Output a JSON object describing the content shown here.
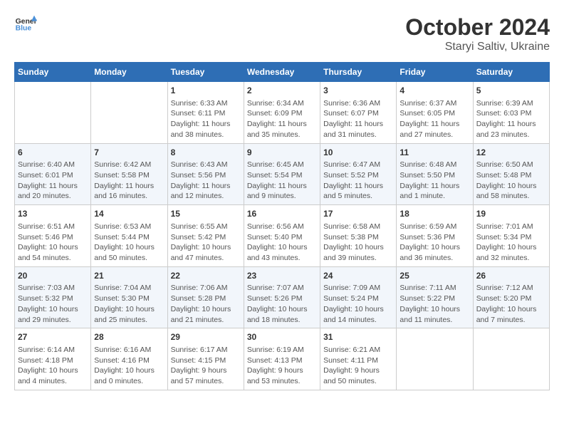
{
  "header": {
    "logo_general": "General",
    "logo_blue": "Blue",
    "month_year": "October 2024",
    "location": "Staryi Saltiv, Ukraine"
  },
  "weekdays": [
    "Sunday",
    "Monday",
    "Tuesday",
    "Wednesday",
    "Thursday",
    "Friday",
    "Saturday"
  ],
  "weeks": [
    [
      {
        "day": "",
        "info": ""
      },
      {
        "day": "",
        "info": ""
      },
      {
        "day": "1",
        "info": "Sunrise: 6:33 AM\nSunset: 6:11 PM\nDaylight: 11 hours and 38 minutes."
      },
      {
        "day": "2",
        "info": "Sunrise: 6:34 AM\nSunset: 6:09 PM\nDaylight: 11 hours and 35 minutes."
      },
      {
        "day": "3",
        "info": "Sunrise: 6:36 AM\nSunset: 6:07 PM\nDaylight: 11 hours and 31 minutes."
      },
      {
        "day": "4",
        "info": "Sunrise: 6:37 AM\nSunset: 6:05 PM\nDaylight: 11 hours and 27 minutes."
      },
      {
        "day": "5",
        "info": "Sunrise: 6:39 AM\nSunset: 6:03 PM\nDaylight: 11 hours and 23 minutes."
      }
    ],
    [
      {
        "day": "6",
        "info": "Sunrise: 6:40 AM\nSunset: 6:01 PM\nDaylight: 11 hours and 20 minutes."
      },
      {
        "day": "7",
        "info": "Sunrise: 6:42 AM\nSunset: 5:58 PM\nDaylight: 11 hours and 16 minutes."
      },
      {
        "day": "8",
        "info": "Sunrise: 6:43 AM\nSunset: 5:56 PM\nDaylight: 11 hours and 12 minutes."
      },
      {
        "day": "9",
        "info": "Sunrise: 6:45 AM\nSunset: 5:54 PM\nDaylight: 11 hours and 9 minutes."
      },
      {
        "day": "10",
        "info": "Sunrise: 6:47 AM\nSunset: 5:52 PM\nDaylight: 11 hours and 5 minutes."
      },
      {
        "day": "11",
        "info": "Sunrise: 6:48 AM\nSunset: 5:50 PM\nDaylight: 11 hours and 1 minute."
      },
      {
        "day": "12",
        "info": "Sunrise: 6:50 AM\nSunset: 5:48 PM\nDaylight: 10 hours and 58 minutes."
      }
    ],
    [
      {
        "day": "13",
        "info": "Sunrise: 6:51 AM\nSunset: 5:46 PM\nDaylight: 10 hours and 54 minutes."
      },
      {
        "day": "14",
        "info": "Sunrise: 6:53 AM\nSunset: 5:44 PM\nDaylight: 10 hours and 50 minutes."
      },
      {
        "day": "15",
        "info": "Sunrise: 6:55 AM\nSunset: 5:42 PM\nDaylight: 10 hours and 47 minutes."
      },
      {
        "day": "16",
        "info": "Sunrise: 6:56 AM\nSunset: 5:40 PM\nDaylight: 10 hours and 43 minutes."
      },
      {
        "day": "17",
        "info": "Sunrise: 6:58 AM\nSunset: 5:38 PM\nDaylight: 10 hours and 39 minutes."
      },
      {
        "day": "18",
        "info": "Sunrise: 6:59 AM\nSunset: 5:36 PM\nDaylight: 10 hours and 36 minutes."
      },
      {
        "day": "19",
        "info": "Sunrise: 7:01 AM\nSunset: 5:34 PM\nDaylight: 10 hours and 32 minutes."
      }
    ],
    [
      {
        "day": "20",
        "info": "Sunrise: 7:03 AM\nSunset: 5:32 PM\nDaylight: 10 hours and 29 minutes."
      },
      {
        "day": "21",
        "info": "Sunrise: 7:04 AM\nSunset: 5:30 PM\nDaylight: 10 hours and 25 minutes."
      },
      {
        "day": "22",
        "info": "Sunrise: 7:06 AM\nSunset: 5:28 PM\nDaylight: 10 hours and 21 minutes."
      },
      {
        "day": "23",
        "info": "Sunrise: 7:07 AM\nSunset: 5:26 PM\nDaylight: 10 hours and 18 minutes."
      },
      {
        "day": "24",
        "info": "Sunrise: 7:09 AM\nSunset: 5:24 PM\nDaylight: 10 hours and 14 minutes."
      },
      {
        "day": "25",
        "info": "Sunrise: 7:11 AM\nSunset: 5:22 PM\nDaylight: 10 hours and 11 minutes."
      },
      {
        "day": "26",
        "info": "Sunrise: 7:12 AM\nSunset: 5:20 PM\nDaylight: 10 hours and 7 minutes."
      }
    ],
    [
      {
        "day": "27",
        "info": "Sunrise: 6:14 AM\nSunset: 4:18 PM\nDaylight: 10 hours and 4 minutes."
      },
      {
        "day": "28",
        "info": "Sunrise: 6:16 AM\nSunset: 4:16 PM\nDaylight: 10 hours and 0 minutes."
      },
      {
        "day": "29",
        "info": "Sunrise: 6:17 AM\nSunset: 4:15 PM\nDaylight: 9 hours and 57 minutes."
      },
      {
        "day": "30",
        "info": "Sunrise: 6:19 AM\nSunset: 4:13 PM\nDaylight: 9 hours and 53 minutes."
      },
      {
        "day": "31",
        "info": "Sunrise: 6:21 AM\nSunset: 4:11 PM\nDaylight: 9 hours and 50 minutes."
      },
      {
        "day": "",
        "info": ""
      },
      {
        "day": "",
        "info": ""
      }
    ]
  ]
}
